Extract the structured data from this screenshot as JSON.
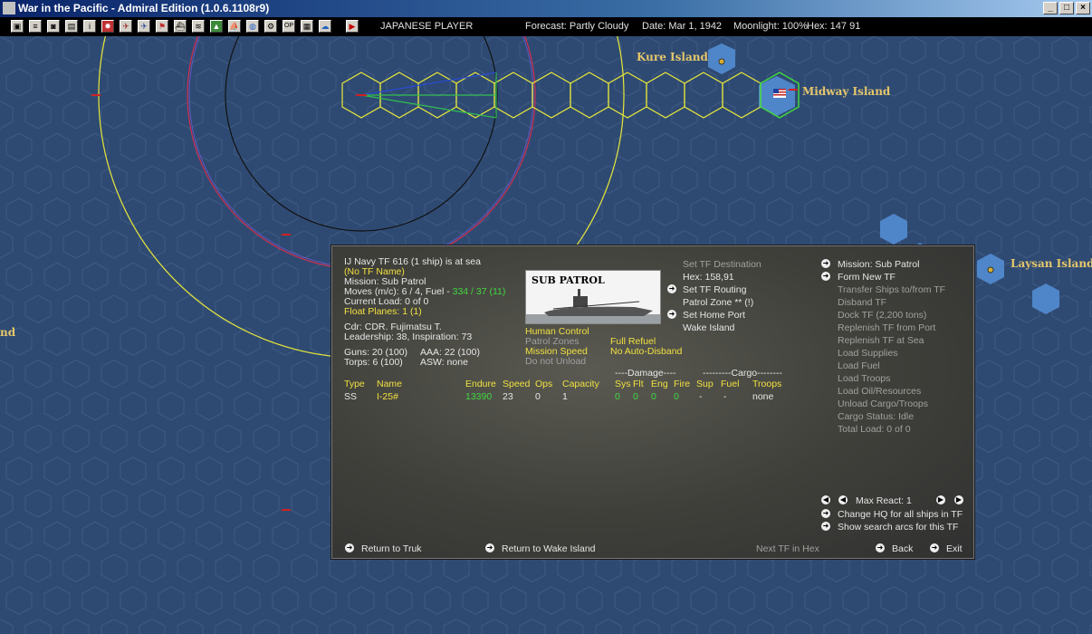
{
  "window": {
    "title": "War in the Pacific - Admiral Edition (1.0.6.1108r9)"
  },
  "toolbar": {
    "player": "JAPANESE PLAYER",
    "forecast": "Forecast: Partly Cloudy",
    "date": "Date: Mar 1, 1942",
    "moonlight": "Moonlight: 100%",
    "hex": "Hex: 147 91"
  },
  "map": {
    "labels": {
      "kure": "Kure Island",
      "midway": "Midway Island",
      "laysan": "Laysan Island",
      "partial_left": "nd"
    },
    "colors": {
      "ocean": "#2f4a72",
      "hex_line": "#3e5a83",
      "route_hex": "#e8e83a",
      "yellow_range": "#e8e83a",
      "red_range": "#d03050",
      "black_range": "#111111",
      "midway_hex": "#40d840",
      "shallows": "#4f86c9"
    }
  },
  "panel": {
    "header": "IJ Navy TF 616 (1 ship) is at sea",
    "tf_name": "(No TF Name)",
    "mission": "Mission: Sub Patrol",
    "moves_prefix": "Moves (m/c): 6 / 4, Fuel - ",
    "moves_fuel": "334 / 37 (11)",
    "current_load": "Current Load: 0 of 0",
    "float_planes": "Float Planes: 1 (1)",
    "cdr": "Cdr: CDR. Fujimatsu T.",
    "leadership": "Leadership: 38, Inspiration: 73",
    "guns": "Guns: 20 (100)",
    "aaa": "AAA: 22 (100)",
    "torps": "Torps: 6 (100)",
    "asw": "ASW: none",
    "photo_label": "SUB PATROL",
    "opts": {
      "human_control": "Human Control",
      "patrol_zones": "Patrol Zones",
      "mission_speed": "Mission Speed",
      "do_not_unload": "Do not Unload",
      "full_refuel": "Full Refuel",
      "no_auto_disband": "No Auto-Disband"
    },
    "dest": {
      "set_tf_destination": "Set TF Destination",
      "hex": "Hex: 158,91",
      "set_tf_routing": "Set TF Routing",
      "patrol_zone": "Patrol Zone ** (!)",
      "set_home_port": "Set Home Port",
      "home_port": "Wake Island"
    },
    "table": {
      "damage_group": "----Damage----",
      "cargo_group": "---------Cargo--------",
      "headers": [
        "Type",
        "Name",
        "Endure",
        "Speed",
        "Ops",
        "Capacity",
        "Sys",
        "Flt",
        "Eng",
        "Fire",
        "Sup",
        "Fuel",
        "Troops"
      ],
      "row": {
        "type": "SS",
        "name": "I-25#",
        "endure": "13390",
        "speed": "23",
        "ops": "0",
        "capacity": "1",
        "sys": "0",
        "flt": "0",
        "eng": "0",
        "fire": "0",
        "sup": "-",
        "fuel": "-",
        "troops": "none"
      }
    },
    "right_menu": {
      "mission": "Mission: Sub Patrol",
      "form_new_tf": "Form New TF",
      "transfer_ships": "Transfer Ships to/from TF",
      "disband_tf": "Disband TF",
      "dock_tf": "Dock TF (2,200 tons)",
      "replenish_port": "Replenish TF from Port",
      "replenish_sea": "Replenish TF at Sea",
      "load_supplies": "Load Supplies",
      "load_fuel": "Load Fuel",
      "load_troops": "Load Troops",
      "load_oil": "Load Oil/Resources",
      "unload_cargo": "Unload Cargo/Troops",
      "cargo_status": "Cargo Status: Idle",
      "total_load": "Total Load: 0 of 0"
    },
    "bottom": {
      "max_react": "Max React:  1",
      "change_hq": "Change HQ for all ships in TF",
      "show_search_arcs": "Show search arcs for this TF",
      "return_truk": "Return to Truk",
      "return_wake": "Return to Wake Island",
      "next_tf": "Next TF in Hex",
      "back": "Back",
      "exit": "Exit"
    }
  }
}
